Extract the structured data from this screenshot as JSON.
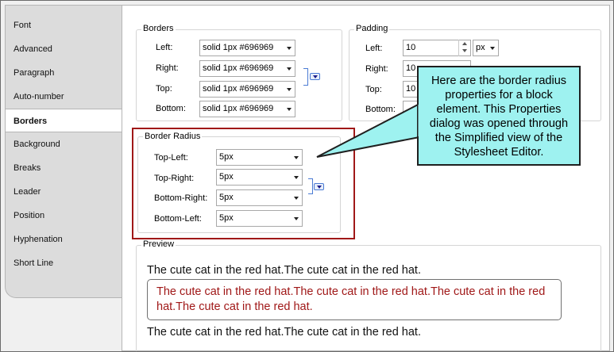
{
  "tabs": [
    {
      "label": "Font"
    },
    {
      "label": "Advanced"
    },
    {
      "label": "Paragraph"
    },
    {
      "label": "Auto-number"
    },
    {
      "label": "Borders",
      "active": true
    },
    {
      "label": "Background"
    },
    {
      "label": "Breaks"
    },
    {
      "label": "Leader"
    },
    {
      "label": "Position"
    },
    {
      "label": "Hyphenation"
    },
    {
      "label": "Short Line"
    }
  ],
  "borders": {
    "title": "Borders",
    "rows": [
      {
        "label": "Left:",
        "value": "solid 1px #696969"
      },
      {
        "label": "Right:",
        "value": "solid 1px #696969"
      },
      {
        "label": "Top:",
        "value": "solid 1px #696969"
      },
      {
        "label": "Bottom:",
        "value": "solid 1px #696969"
      }
    ]
  },
  "padding": {
    "title": "Padding",
    "rows": [
      {
        "label": "Left:",
        "value": "10",
        "unit": "px"
      },
      {
        "label": "Right:",
        "value": "10"
      },
      {
        "label": "Top:",
        "value": "10"
      },
      {
        "label": "Bottom:",
        "value": ""
      }
    ]
  },
  "border_radius": {
    "title": "Border Radius",
    "rows": [
      {
        "label": "Top-Left:",
        "value": "5px"
      },
      {
        "label": "Top-Right:",
        "value": "5px"
      },
      {
        "label": "Bottom-Right:",
        "value": "5px"
      },
      {
        "label": "Bottom-Left:",
        "value": "5px"
      }
    ]
  },
  "preview": {
    "title": "Preview",
    "line_top": "The cute cat in the red hat.The cute cat in the red hat.",
    "box_text": "The cute cat in the red hat.The cute cat in the red hat.The cute cat in the red hat.The cute cat in the red hat.",
    "line_bottom": "The cute cat in the red hat.The cute cat in the red hat."
  },
  "callout": {
    "text": "Here are the border radius properties for a block element. This Properties dialog was opened through the Simplified view of the Stylesheet Editor."
  },
  "colors": {
    "highlight_border": "#a01818",
    "callout_fill": "#9ef2f0",
    "preview_text": "#a01818",
    "link_bracket": "#4a7bd4"
  }
}
